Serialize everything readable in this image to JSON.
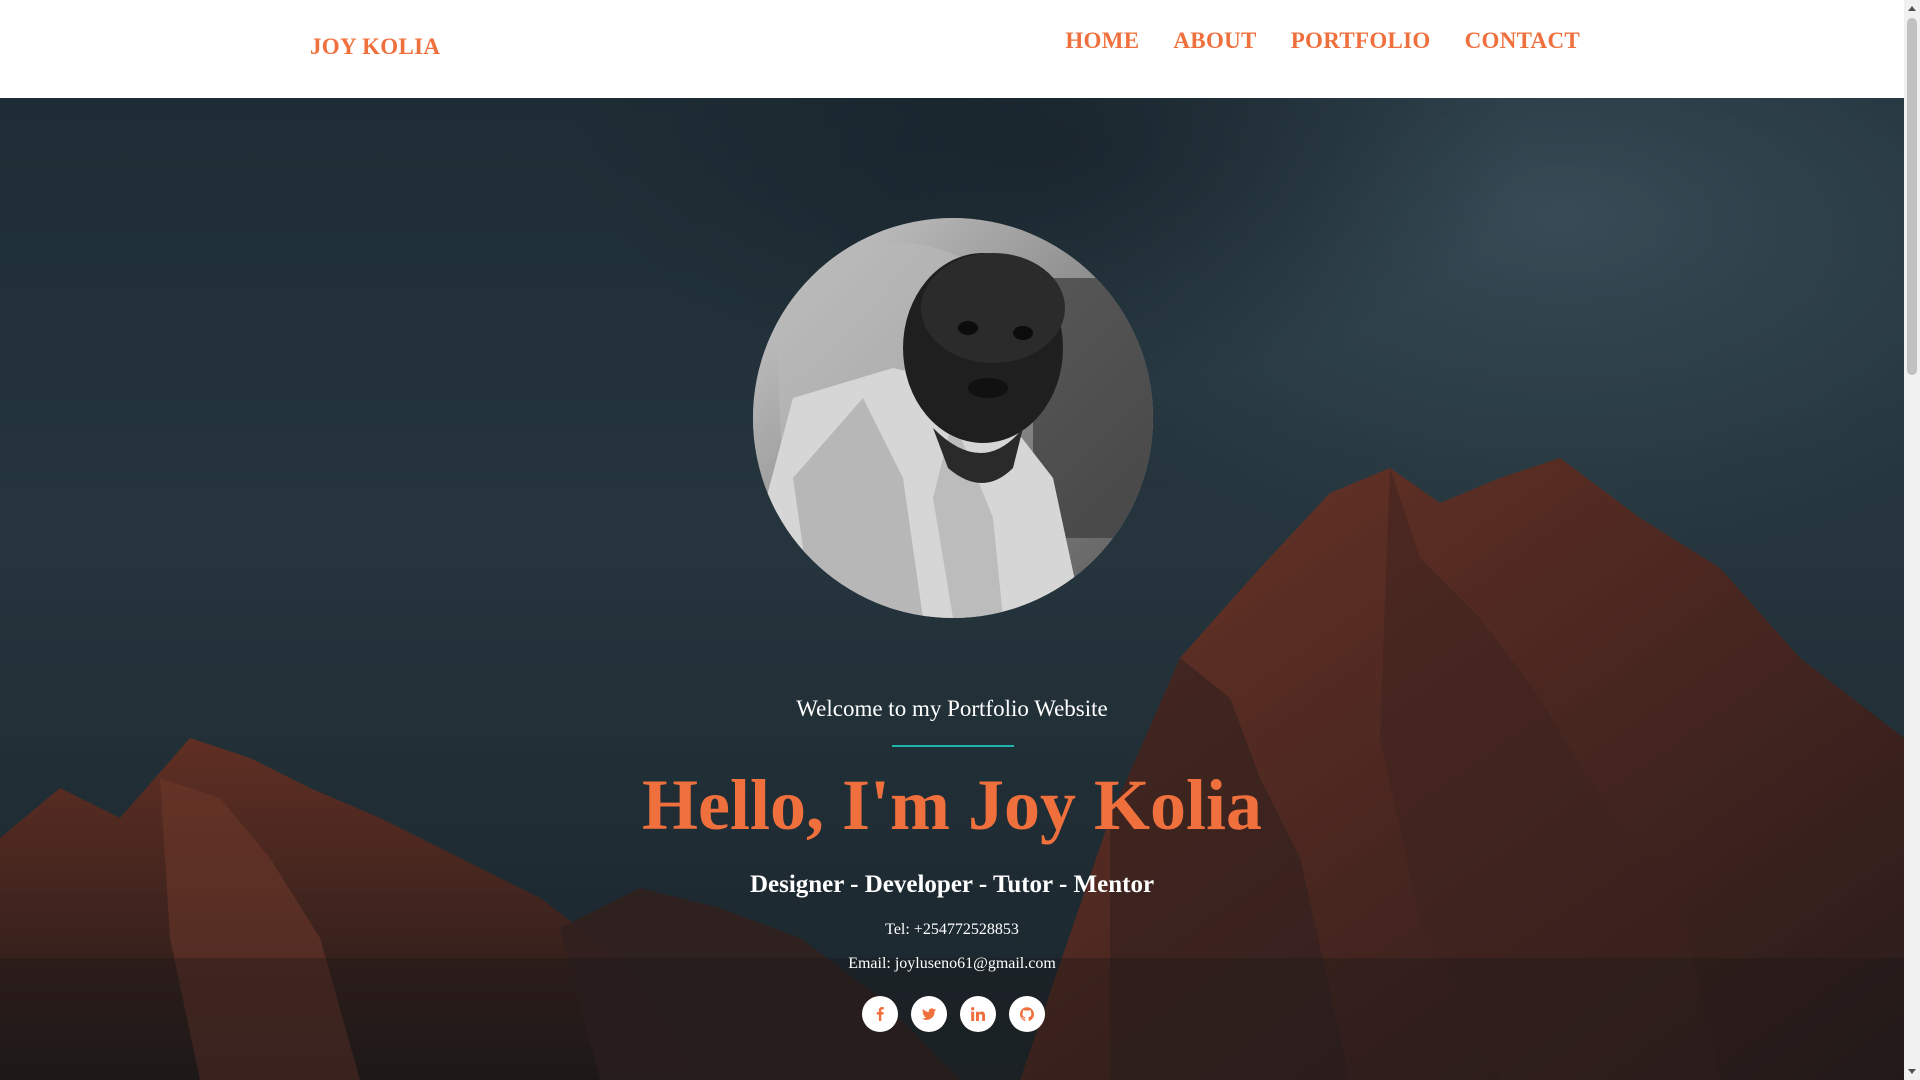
{
  "navbar": {
    "brand": "JOY KOLIA",
    "links": [
      {
        "label": "HOME"
      },
      {
        "label": "ABOUT"
      },
      {
        "label": "PORTFOLIO"
      },
      {
        "label": "CONTACT"
      }
    ]
  },
  "hero": {
    "background": "dark-mountain-landscape-photo",
    "avatar": "profile-photo",
    "welcome": "Welcome to my Portfolio Website",
    "headline": "Hello, I'm Joy Kolia",
    "subhead": "Designer - Developer - Tutor - Mentor",
    "tel": "Tel: +254772528853",
    "email": "Email: joyluseno61@gmail.com",
    "socials": [
      {
        "icon": "facebook-icon"
      },
      {
        "icon": "twitter-icon"
      },
      {
        "icon": "linkedin-icon"
      },
      {
        "icon": "github-icon"
      }
    ]
  },
  "colors": {
    "accent": "#f0703d",
    "divider": "#1fb5ac",
    "text_light": "#ffffff"
  }
}
